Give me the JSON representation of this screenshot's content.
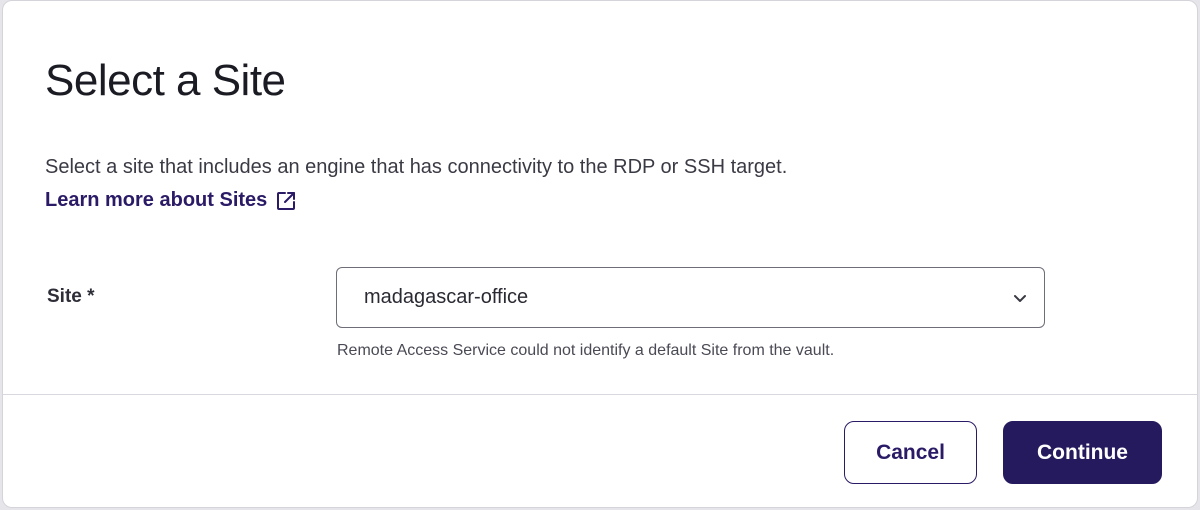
{
  "dialog": {
    "title": "Select a Site",
    "description": "Select a site that includes an engine that has connectivity to the RDP or SSH target.",
    "learn_more_label": "Learn more about Sites",
    "learn_more_icon": "external-link-icon"
  },
  "form": {
    "site_label": "Site *",
    "site_value": "madagascar-office",
    "site_chevron_icon": "chevron-down-icon",
    "hint": "Remote Access Service could not identify a default Site from the vault."
  },
  "footer": {
    "cancel_label": "Cancel",
    "continue_label": "Continue"
  },
  "colors": {
    "primary": "#261a5e",
    "link": "#2b1a66",
    "text": "#1b1b24"
  }
}
